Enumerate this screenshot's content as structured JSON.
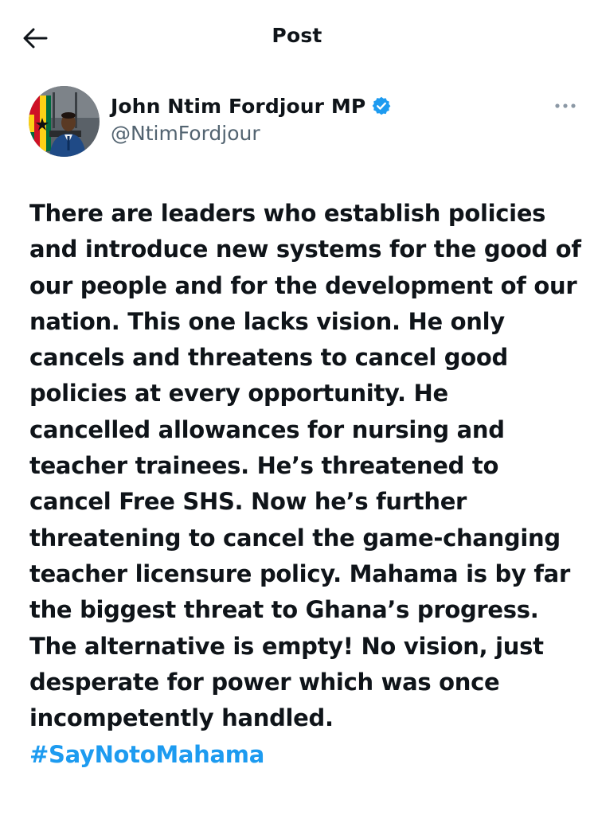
{
  "header": {
    "title": "Post",
    "back_icon": "arrow-left-icon"
  },
  "author": {
    "display_name": "John Ntim Fordjour MP",
    "handle": "@NtimFordjour",
    "verified": true,
    "verified_color": "#1d9bf0",
    "avatar": "profile-photo"
  },
  "post": {
    "text": "There are leaders who establish policies\nand introduce new systems for the good of\nour people and for the development of our\nnation. This one lacks vision. He only\ncancels and threatens to cancel good\npolicies at every opportunity. He\ncancelled allowances for nursing and\nteacher trainees. He’s threatened to\ncancel Free SHS. Now he’s further\nthreatening to cancel the game-changing\nteacher licensure policy. Mahama is by far\nthe biggest threat to Ghana’s progress.\nThe alternative is empty! No vision, just\ndesperate for power which was once\nincompetently handled.",
    "hashtag": "#SayNotoMahama",
    "hashtag_color": "#1d9bf0"
  },
  "icons": {
    "more": "more-horizontal-icon"
  }
}
